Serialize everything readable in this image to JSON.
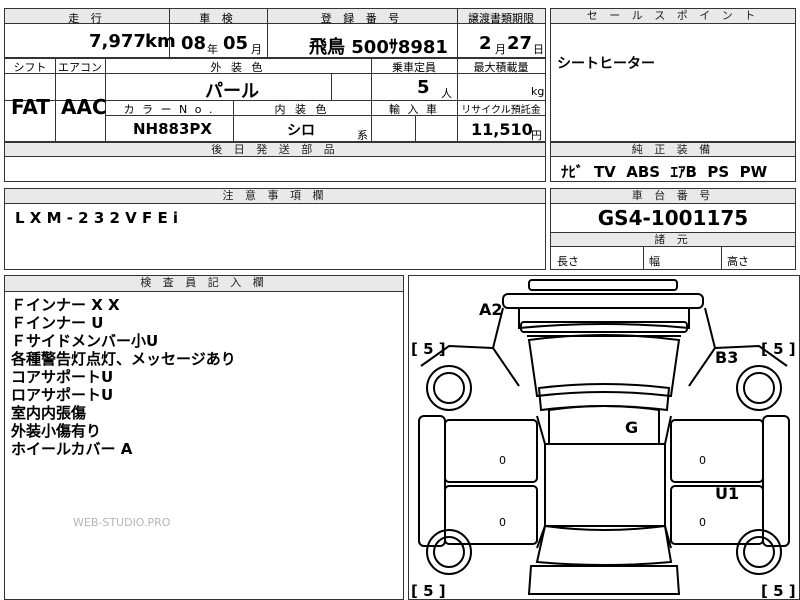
{
  "top_bar": {
    "headers": {
      "mileage": "走 行",
      "inspection": "車 検",
      "registration": "登 録 番 号",
      "transfer_deadline": "譲渡書類期限",
      "sales_point": "セ ー ル ス ポ イ ン ト"
    },
    "mileage_value": "7,977",
    "mileage_unit": "km",
    "inspection_year": "08",
    "inspection_year_unit": "年",
    "inspection_month": "05",
    "inspection_month_unit": "月",
    "registration_value": "飛鳥 500ｻ8981",
    "transfer_month": "2",
    "transfer_month_unit": "月",
    "transfer_day": "27",
    "transfer_day_unit": "日"
  },
  "spec": {
    "headers": {
      "shift": "シフト",
      "aircon": "エアコン",
      "exterior_color": "外 装 色",
      "capacity": "乗車定員",
      "max_load": "最大積載量",
      "color_no": "カ ラ ー N o .",
      "interior_color": "内 装 色",
      "import": "輸 入 車",
      "recycle": "リサイクル預託金"
    },
    "shift_value": "FAT",
    "aircon_value": "AAC",
    "exterior_color_value": "パール",
    "capacity_value": "5",
    "capacity_unit": "人",
    "max_load_unit": "kg",
    "color_no_value": "NH883PX",
    "interior_color_value": "シロ",
    "interior_color_suffix": "系",
    "recycle_value": "11,510",
    "recycle_unit": "円"
  },
  "sales_point_text": "シートヒーター",
  "later_parts_header": "後 日 発 送 部 品",
  "factory_equipment": {
    "header": "純 正 装 備",
    "value": "ﾅﾋﾞ  TV  ABS  ｴｱB  PS  PW"
  },
  "notes_box": {
    "header": "注 意 事 項 欄",
    "value": "L X M - 2 3 2 V F E i"
  },
  "chassis": {
    "header": "車 台 番 号",
    "value": "GS4-1001175"
  },
  "dimensions": {
    "header": "諸 元",
    "length": "長さ",
    "width": "幅",
    "height": "高さ"
  },
  "inspector": {
    "header": "検 査 員 記 入 欄",
    "lines": [
      "Ｆインナー X X",
      "Ｆインナー U",
      "Ｆサイドメンバー小U",
      "各種警告灯点灯、メッセージあり",
      "コアサポートU",
      "ロアサポートU",
      "室内内張傷",
      "外装小傷有り",
      "ホイールカバー A"
    ]
  },
  "watermark": "WEB-STUDIO.PRO",
  "diagram": {
    "marks": {
      "a2": "A2",
      "b3": "B3",
      "g": "G",
      "u1": "U1"
    },
    "tire_fl": "[ 5 ]",
    "tire_fr": "[ 5 ]",
    "tire_rl": "[ 5 ]",
    "tire_rr": "[ 5 ]",
    "zero": "0"
  }
}
